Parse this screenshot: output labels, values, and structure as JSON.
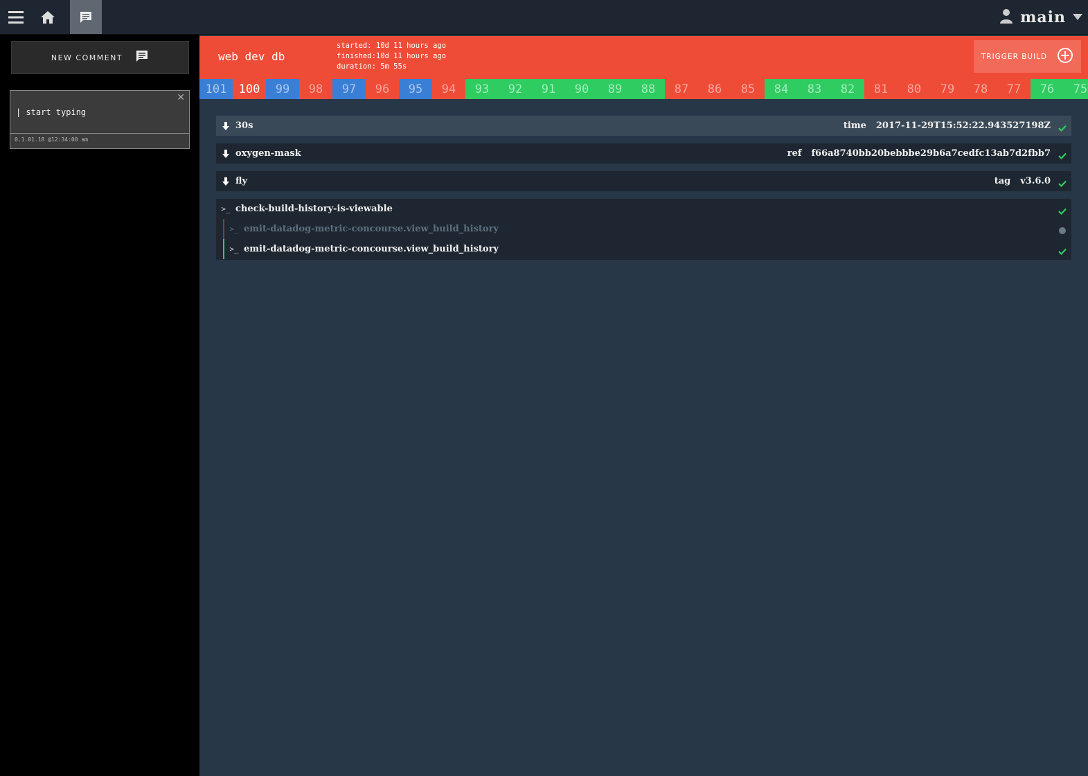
{
  "topbar": {
    "menu_icon": "hamburger-menu-icon",
    "home_icon": "home-icon",
    "comments_icon": "comment-icon",
    "user_icon": "user-icon",
    "team_name": "main",
    "dropdown_icon": "caret-down-icon"
  },
  "sidebar": {
    "new_comment_label": "NEW COMMENT",
    "comment": {
      "text": "| start typing",
      "meta": "0.1.01.18 @12:34:00 am",
      "close_glyph": "✕"
    }
  },
  "header": {
    "job_name": "web dev db",
    "started": "started: 10d 11 hours ago",
    "finished": "finished:10d 11 hours ago",
    "duration": "duration: 5m 55s",
    "trigger_label": "TRIGGER BUILD",
    "color": "#ef4c38"
  },
  "builds": [
    {
      "num": "101",
      "status": "blue"
    },
    {
      "num": "100",
      "status": "red",
      "current": true
    },
    {
      "num": "99",
      "status": "blue"
    },
    {
      "num": "98",
      "status": "red"
    },
    {
      "num": "97",
      "status": "blue"
    },
    {
      "num": "96",
      "status": "red"
    },
    {
      "num": "95",
      "status": "blue"
    },
    {
      "num": "94",
      "status": "red"
    },
    {
      "num": "93",
      "status": "green"
    },
    {
      "num": "92",
      "status": "green"
    },
    {
      "num": "91",
      "status": "green"
    },
    {
      "num": "90",
      "status": "green"
    },
    {
      "num": "89",
      "status": "green"
    },
    {
      "num": "88",
      "status": "green"
    },
    {
      "num": "87",
      "status": "red"
    },
    {
      "num": "86",
      "status": "red"
    },
    {
      "num": "85",
      "status": "red"
    },
    {
      "num": "84",
      "status": "green"
    },
    {
      "num": "83",
      "status": "green"
    },
    {
      "num": "82",
      "status": "green"
    },
    {
      "num": "81",
      "status": "red"
    },
    {
      "num": "80",
      "status": "red"
    },
    {
      "num": "79",
      "status": "red"
    },
    {
      "num": "78",
      "status": "red"
    },
    {
      "num": "77",
      "status": "red"
    },
    {
      "num": "76",
      "status": "green"
    },
    {
      "num": "75",
      "status": "green"
    }
  ],
  "steps": [
    {
      "name": "30s",
      "key": "time",
      "value": "2017-11-29T15:52:22.943527198Z",
      "highlight": true
    },
    {
      "name": "oxygen-mask",
      "key": "ref",
      "value": "f66a8740bb20bebbbe29b6a7cedfc13ab7d2fbb7"
    },
    {
      "name": "fly",
      "key": "tag",
      "value": "v3.6.0"
    }
  ],
  "task": {
    "name": "check-build-history-is-viewable",
    "subtasks": [
      {
        "name": "emit-datadog-metric-concourse.view_build_history",
        "state": "pending"
      },
      {
        "name": "emit-datadog-metric-concourse.view_build_history",
        "state": "ok"
      }
    ]
  },
  "colors": {
    "success": "#2ecc61",
    "failed": "#ef4c38",
    "running": "#3a7fd6"
  }
}
